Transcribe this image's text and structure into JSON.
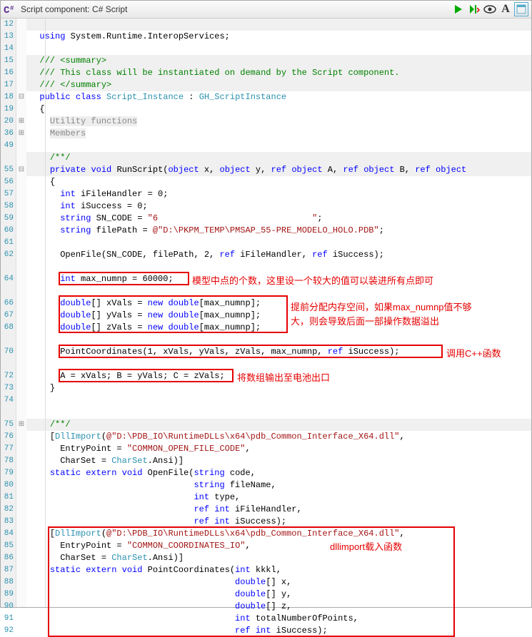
{
  "header": {
    "title": "Script component: C# Script"
  },
  "gutter": [
    "12",
    "13",
    "14",
    "15",
    "16",
    "17",
    "18",
    "19",
    "20",
    "36",
    "49",
    " ",
    "55",
    "56",
    "57",
    "58",
    "59",
    "60",
    "61",
    "62",
    " ",
    "64",
    " ",
    "66",
    "67",
    "68",
    " ",
    "70",
    " ",
    "72",
    "73",
    "74",
    " ",
    "75",
    "76",
    "77",
    "78",
    "79",
    "80",
    "81",
    "82",
    "83",
    "84",
    "85",
    "86",
    "87",
    "88",
    "89",
    "90",
    "91",
    "92"
  ],
  "fold": [
    "",
    "",
    "",
    "",
    "",
    "",
    "⊟",
    "",
    "⊞",
    "⊞",
    "",
    "",
    "⊟",
    "",
    "",
    "",
    "",
    "",
    "",
    "",
    "",
    "",
    "",
    "",
    "",
    "",
    "",
    "",
    "",
    "",
    "",
    "",
    "",
    "⊞",
    "",
    "",
    "",
    "",
    "",
    "",
    "",
    "",
    "",
    "",
    "",
    "",
    "",
    "",
    "",
    "",
    "",
    ""
  ],
  "code": {
    "l0": "",
    "l1a": "using",
    "l1b": " System.Runtime.InteropServices;",
    "l2": "",
    "l3a": "///",
    "l3b": " <summary>",
    "l4a": "///",
    "l4b": " This class will be instantiated on demand by the Script component.",
    "l5a": "///",
    "l5b": " </summary>",
    "l6a": "public",
    "l6b": "class",
    "l6c": "Script_Instance",
    "l6d": "GH_ScriptInstance",
    "l7": "{",
    "l8": "Utility functions",
    "l9": "Members",
    "l11": "/**/",
    "l12a": "private",
    "l12b": "void",
    "l12c": "RunScript",
    "l12d": "object",
    "l12e": "object",
    "l12f": "ref",
    "l12g": "object",
    "l12h": "ref",
    "l12i": "object",
    "l12j": "ref",
    "l12k": "object",
    "l13": "{",
    "l14a": "int",
    "l14b": " iFileHandler = 0;",
    "l15a": "int",
    "l15b": " iSuccess = 0;",
    "l16a": "string",
    "l16b": " SN_CODE = ",
    "l16c": "\"6                              \"",
    "l17a": "string",
    "l17b": " filePath = ",
    "l17c": "@\"D:\\PKPM_TEMP\\PMSAP_55-PRE_MODELO_HOLO.PDB\"",
    "l19a": "OpenFile(SN_CODE, filePath, 2, ",
    "l19b": "ref",
    "l19c": " iFileHandler, ",
    "l19d": "ref",
    "l19e": " iSuccess);",
    "l21a": "int",
    "l21b": " max_numnp = 60000;",
    "l23a": "double",
    "l23b": "[] xVals = ",
    "l23c": "new",
    "l23d": "double",
    "l23e": "[max_numnp];",
    "l24a": "double",
    "l24b": "[] yVals = ",
    "l24c": "new",
    "l24d": "double",
    "l24e": "[max_numnp];",
    "l25a": "double",
    "l25b": "[] zVals = ",
    "l25c": "new",
    "l25d": "double",
    "l25e": "[max_numnp];",
    "l27a": "PointCoordinates(1, xVals, yVals, zVals, max_numnp, ",
    "l27b": "ref",
    "l27c": " iSuccess);",
    "l29": "A = xVals; B = yVals; C = zVals;",
    "l30": "}",
    "l32": "/**/",
    "l33a": "[",
    "l33b": "DllImport",
    "l33c": "(",
    "l33d": "@\"D:\\PDB_IO\\RuntimeDLLs\\x64\\pdb_Common_Interface_X64.dll\"",
    "l33e": ",",
    "l34a": "  EntryPoint = ",
    "l34b": "\"COMMON_OPEN_FILE_CODE\"",
    "l34c": ",",
    "l35a": "  CharSet = ",
    "l35b": "CharSet",
    "l35c": ".Ansi)]",
    "l36a": "static",
    "l36b": "extern",
    "l36c": "void",
    "l36d": "OpenFile",
    "l36e": "string",
    "l36f": " code,",
    "l37a": "string",
    "l37b": " fileName,",
    "l38a": "int",
    "l38b": " type,",
    "l39a": "ref",
    "l39b": "int",
    "l39c": " iFileHandler,",
    "l40a": "ref",
    "l40b": "int",
    "l40c": " iSuccess);",
    "l41a": "[",
    "l41b": "DllImport",
    "l41c": "(",
    "l41d": "@\"D:\\PDB_IO\\RuntimeDLLs\\x64\\pdb_Common_Interface_X64.dll\"",
    "l41e": ",",
    "l42a": "  EntryPoint = ",
    "l42b": "\"COMMON_COORDINATES_IO\"",
    "l42c": ",",
    "l43a": "  CharSet = ",
    "l43b": "CharSet",
    "l43c": ".Ansi)]",
    "l44a": "static",
    "l44b": "extern",
    "l44c": "void",
    "l44d": "PointCoordinates",
    "l44e": "int",
    "l44f": " kkkl,",
    "l45a": "double",
    "l45b": "[] x,",
    "l46a": "double",
    "l46b": "[] y,",
    "l47a": "double",
    "l47b": "[] z,",
    "l48a": "int",
    "l48b": " totalNumberOfPoints,",
    "l49a": "ref",
    "l49b": "int",
    "l49c": " iSuccess);"
  },
  "anno": {
    "a1": "模型中点的个数，这里设一个较大的值可以装进所有点即可",
    "a2": "提前分配内存空间，如果max_numnp值不够",
    "a3": "大，则会导致后面一部操作数据溢出",
    "a4": "调用C++函数",
    "a5": "将数组输出至电池出口",
    "a6": "dllimport载入函数"
  }
}
